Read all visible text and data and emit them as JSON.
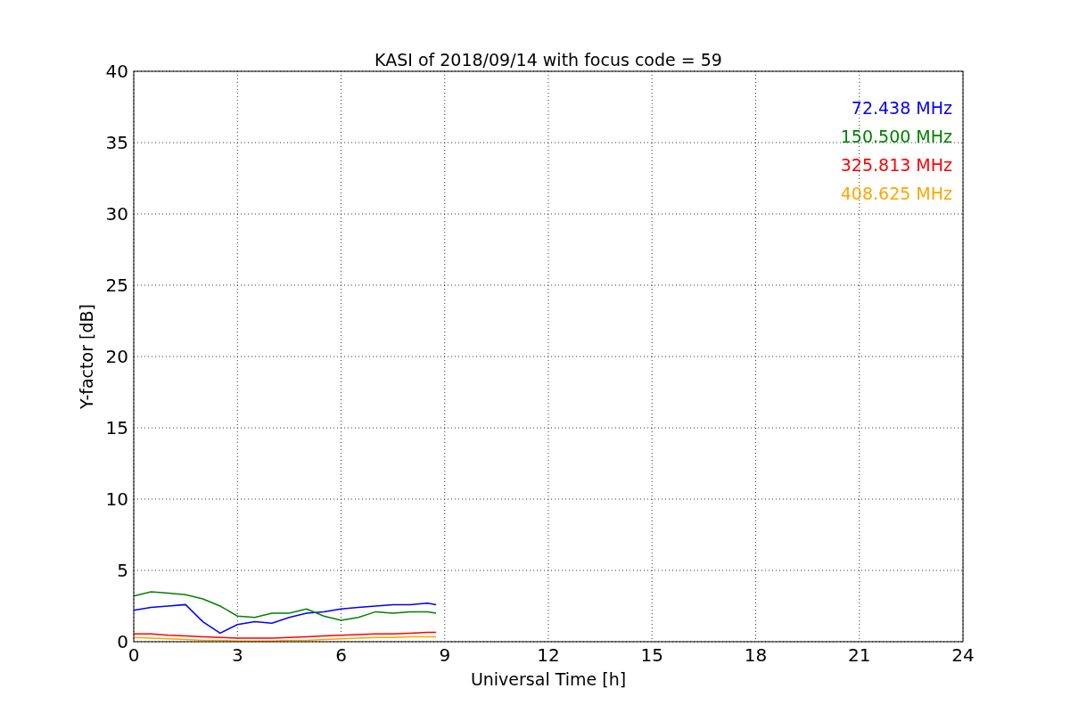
{
  "chart_data": {
    "type": "line",
    "title": "KASI of 2018/09/14 with focus code = 59",
    "xlabel": "Universal Time [h]",
    "ylabel": "Y-factor [dB]",
    "x": [
      0,
      0.5,
      1,
      1.5,
      2,
      2.5,
      3,
      3.5,
      4,
      4.5,
      5,
      5.5,
      6,
      6.5,
      7,
      7.5,
      8,
      8.5,
      8.75
    ],
    "series": [
      {
        "name": "72.438 MHz",
        "color": "#0000ff",
        "values": [
          2.2,
          2.4,
          2.5,
          2.6,
          1.4,
          0.6,
          1.2,
          1.4,
          1.3,
          1.7,
          2.0,
          2.1,
          2.3,
          2.4,
          2.5,
          2.6,
          2.6,
          2.7,
          2.6
        ]
      },
      {
        "name": "150.500 MHz",
        "color": "#008000",
        "values": [
          3.2,
          3.5,
          3.4,
          3.3,
          3.0,
          2.5,
          1.8,
          1.7,
          2.0,
          2.0,
          2.3,
          1.8,
          1.5,
          1.7,
          2.1,
          2.0,
          2.1,
          2.1,
          2.0
        ]
      },
      {
        "name": "325.813 MHz",
        "color": "#ff0000",
        "values": [
          0.55,
          0.55,
          0.45,
          0.4,
          0.35,
          0.3,
          0.25,
          0.25,
          0.25,
          0.3,
          0.35,
          0.4,
          0.45,
          0.5,
          0.55,
          0.55,
          0.6,
          0.65,
          0.65
        ]
      },
      {
        "name": "408.625 MHz",
        "color": "#ffa500",
        "values": [
          0.3,
          0.25,
          0.2,
          0.15,
          0.1,
          0.1,
          0.05,
          0.05,
          0.05,
          0.1,
          0.1,
          0.15,
          0.2,
          0.25,
          0.3,
          0.3,
          0.35,
          0.35,
          0.35
        ]
      }
    ],
    "grid": true,
    "xlim": [
      0,
      24
    ],
    "ylim": [
      0,
      40
    ],
    "xticks": [
      0,
      3,
      6,
      9,
      12,
      15,
      18,
      21,
      24
    ],
    "yticks": [
      0,
      5,
      10,
      15,
      20,
      25,
      30,
      35,
      40
    ]
  }
}
